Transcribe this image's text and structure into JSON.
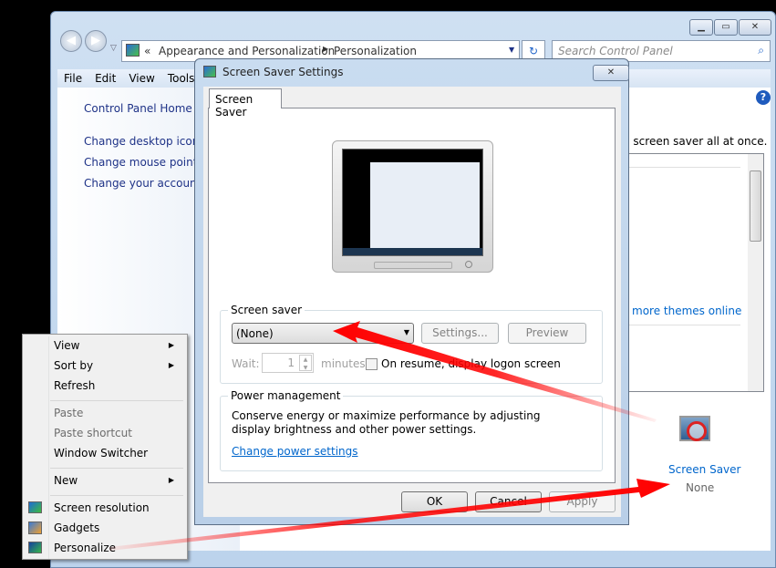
{
  "window": {
    "breadcrumb": {
      "prefix": "«",
      "items": [
        "Appearance and Personalization",
        "Personalization"
      ]
    },
    "search_placeholder": "Search Control Panel",
    "menu": [
      "File",
      "Edit",
      "View",
      "Tools"
    ],
    "left_links": [
      "Control Panel Home",
      "Change desktop icons",
      "Change mouse pointers",
      "Change your account picture"
    ],
    "main_text": "d screen saver all at once.",
    "themes_link": "more themes online",
    "screen_saver_tile": {
      "label": "Screen Saver",
      "value": "None"
    }
  },
  "dialog": {
    "title": "Screen Saver Settings",
    "tab": "Screen Saver",
    "screen_saver_group": "Screen saver",
    "selected": "(None)",
    "settings_btn": "Settings...",
    "preview_btn": "Preview",
    "wait_label": "Wait:",
    "wait_value": "1",
    "minutes_label": "minutes",
    "resume_label": "On resume, display logon screen",
    "resume_checked": false,
    "power_group": "Power management",
    "power_text": "Conserve energy or maximize performance by adjusting display brightness and other power settings.",
    "power_link": "Change power settings",
    "ok": "OK",
    "cancel": "Cancel",
    "apply": "Apply"
  },
  "context_menu": {
    "items": [
      {
        "label": "View",
        "submenu": true
      },
      {
        "label": "Sort by",
        "submenu": true
      },
      {
        "label": "Refresh"
      },
      {
        "label": "Paste",
        "disabled": true
      },
      {
        "label": "Paste shortcut",
        "disabled": true
      },
      {
        "label": "Window Switcher"
      },
      {
        "label": "New",
        "submenu": true
      },
      {
        "label": "Screen resolution",
        "icon": "monitor-icon"
      },
      {
        "label": "Gadgets",
        "icon": "gadgets-icon"
      },
      {
        "label": "Personalize",
        "icon": "personalize-icon"
      }
    ]
  },
  "colors": {
    "annotation_arrow": "#ff0000",
    "link": "#0066cc"
  }
}
